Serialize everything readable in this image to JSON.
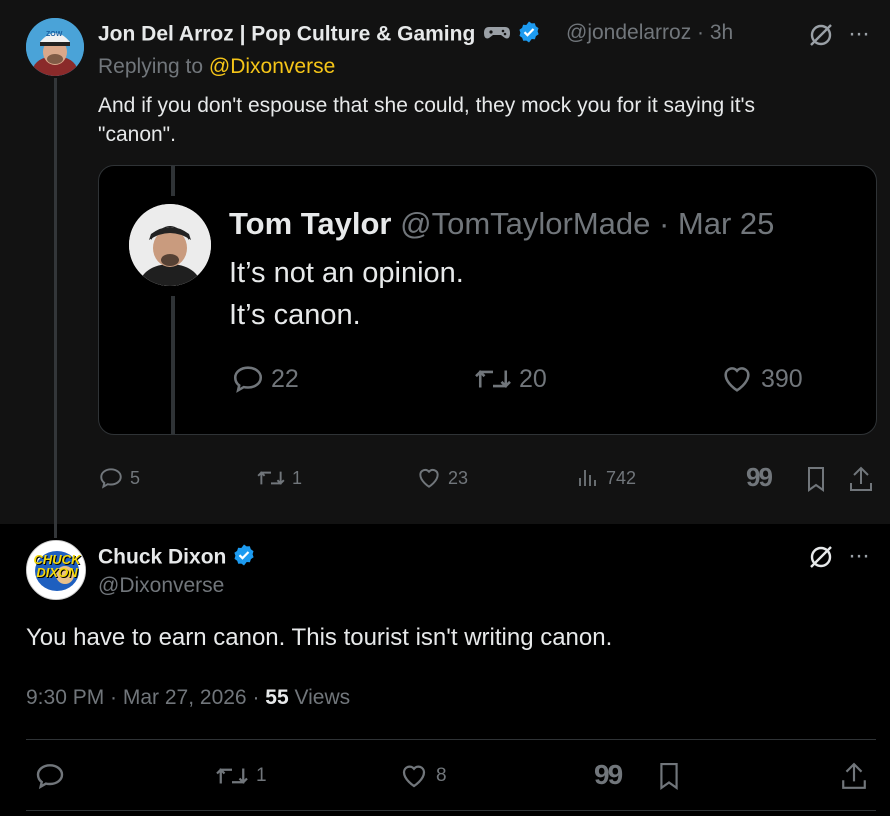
{
  "reply": {
    "author_name": "Jon Del Arroz | Pop Culture & Gaming",
    "handle_time": "@jondelarroz · 3h",
    "replying_prefix": "Replying to",
    "replying_handle": "@Dixonverse",
    "text_line1": "And if you don't espouse that she could, they mock you for it saying it's",
    "text_line2": "\"canon\".",
    "avatar_cap_text": "ZOW",
    "stats": {
      "replies": "5",
      "reposts": "1",
      "likes": "23",
      "views": "742"
    }
  },
  "quoted": {
    "author_name": "Tom Taylor",
    "handle_date": "@TomTaylorMade · Mar 25",
    "line1": "It’s not an opinion.",
    "line2": "It’s canon.",
    "stats": {
      "replies": "22",
      "reposts": "20",
      "likes": "390"
    }
  },
  "main": {
    "author_name": "Chuck Dixon",
    "handle": "@Dixonverse",
    "avatar_text_line1": "CHUCK",
    "avatar_text_line2": "DIXON",
    "text": "You have to earn canon. This tourist isn't writing canon.",
    "timestamp": "9:30 PM · Mar 27, 2026 · ",
    "views_count": "55",
    "views_label": " Views",
    "stats": {
      "reposts": "1",
      "likes": "8"
    }
  },
  "colors": {
    "accent": "#1d9bf0",
    "mention": "#f5c518",
    "text": "#e7e9ea",
    "muted": "#71767b"
  }
}
